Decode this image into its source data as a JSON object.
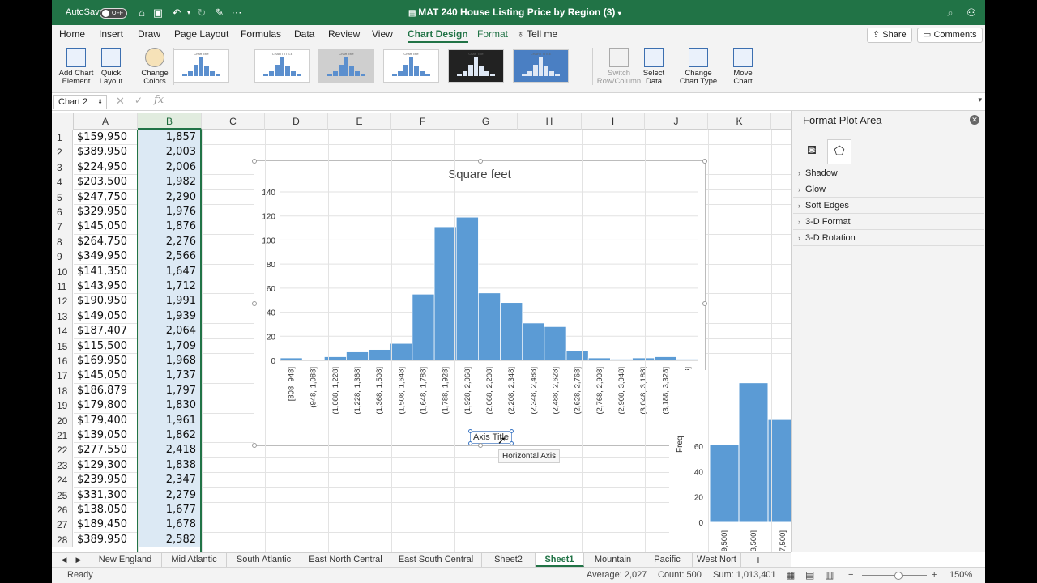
{
  "titlebar": {
    "autosave_label": "AutoSave",
    "autosave_state": "OFF",
    "doc_title": "MAT 240 House Listing Price by Region (3)"
  },
  "menu": {
    "tabs": [
      "Home",
      "Insert",
      "Draw",
      "Page Layout",
      "Formulas",
      "Data",
      "Review",
      "View",
      "Chart Design",
      "Format"
    ],
    "active": "Chart Design",
    "tell_me": "Tell me",
    "share": "Share",
    "comments": "Comments"
  },
  "ribbon": {
    "add_chart_element": "Add Chart Element",
    "quick_layout": "Quick Layout",
    "change_colors": "Change Colors",
    "switch_row_column": "Switch Row/Column",
    "select_data": "Select Data",
    "change_chart_type": "Change Chart Type",
    "move_chart": "Move Chart"
  },
  "formula_bar": {
    "name_box": "Chart 2",
    "fx": "fx"
  },
  "sheet": {
    "columns": [
      "A",
      "B",
      "C",
      "D",
      "E",
      "F",
      "G",
      "H",
      "I",
      "J",
      "K"
    ],
    "rows": [
      {
        "n": "1",
        "a": "$159,950",
        "b": "1,857"
      },
      {
        "n": "2",
        "a": "$389,950",
        "b": "2,003"
      },
      {
        "n": "3",
        "a": "$224,950",
        "b": "2,006"
      },
      {
        "n": "4",
        "a": "$203,500",
        "b": "1,982"
      },
      {
        "n": "5",
        "a": "$247,750",
        "b": "2,290"
      },
      {
        "n": "6",
        "a": "$329,950",
        "b": "1,976"
      },
      {
        "n": "7",
        "a": "$145,050",
        "b": "1,876"
      },
      {
        "n": "8",
        "a": "$264,750",
        "b": "2,276"
      },
      {
        "n": "9",
        "a": "$349,950",
        "b": "2,566"
      },
      {
        "n": "10",
        "a": "$141,350",
        "b": "1,647"
      },
      {
        "n": "11",
        "a": "$143,950",
        "b": "1,712"
      },
      {
        "n": "12",
        "a": "$190,950",
        "b": "1,991"
      },
      {
        "n": "13",
        "a": "$149,050",
        "b": "1,939"
      },
      {
        "n": "14",
        "a": "$187,407",
        "b": "2,064"
      },
      {
        "n": "15",
        "a": "$115,500",
        "b": "1,709"
      },
      {
        "n": "16",
        "a": "$169,950",
        "b": "1,968"
      },
      {
        "n": "17",
        "a": "$145,050",
        "b": "1,737"
      },
      {
        "n": "18",
        "a": "$186,879",
        "b": "1,797"
      },
      {
        "n": "19",
        "a": "$179,800",
        "b": "1,830"
      },
      {
        "n": "20",
        "a": "$179,400",
        "b": "1,961"
      },
      {
        "n": "21",
        "a": "$139,050",
        "b": "1,862"
      },
      {
        "n": "22",
        "a": "$277,550",
        "b": "2,418"
      },
      {
        "n": "23",
        "a": "$129,300",
        "b": "1,838"
      },
      {
        "n": "24",
        "a": "$239,950",
        "b": "2,347"
      },
      {
        "n": "25",
        "a": "$331,300",
        "b": "2,279"
      },
      {
        "n": "26",
        "a": "$138,050",
        "b": "1,677"
      },
      {
        "n": "27",
        "a": "$189,450",
        "b": "1,678"
      },
      {
        "n": "28",
        "a": "$389,950",
        "b": "2,582"
      }
    ]
  },
  "chart": {
    "axis_title": "Axis Title",
    "tooltip": "Horizontal Axis"
  },
  "chart_data": [
    {
      "type": "bar",
      "title": "Square feet",
      "xlabel": "Axis Title",
      "ylabel": "",
      "ylim": [
        0,
        140
      ],
      "yticks": [
        0,
        20,
        40,
        60,
        80,
        100,
        120,
        140
      ],
      "categories": [
        "[808, 948]",
        "(948, 1,088]",
        "(1,088, 1,228]",
        "(1,228, 1,368]",
        "(1,368, 1,508]",
        "(1,508, 1,648]",
        "(1,648, 1,788]",
        "(1,788, 1,928]",
        "(1,928, 2,068]",
        "(2,068, 2,208]",
        "(2,208, 2,348]",
        "(2,348, 2,488]",
        "(2,488, 2,628]",
        "(2,628, 2,768]",
        "(2,768, 2,908]",
        "(2,908, 3,048]",
        "(3,048, 3,188]",
        "(3,188, 3,328]",
        "(3,328, 3,468]"
      ],
      "values": [
        2,
        0,
        3,
        7,
        9,
        14,
        55,
        111,
        119,
        56,
        48,
        31,
        28,
        8,
        2,
        1,
        2,
        3,
        1
      ],
      "grid": true
    },
    {
      "type": "bar",
      "title": "",
      "xlabel": "",
      "ylabel": "Freq",
      "ylim": [
        0,
        120
      ],
      "yticks": [
        0,
        20,
        40,
        60
      ],
      "categories": [
        "9,500]",
        "3,500]",
        "7,500]"
      ],
      "values": [
        61,
        110,
        81
      ],
      "grid": false
    }
  ],
  "pane": {
    "title": "Format Plot Area",
    "sections": [
      "Shadow",
      "Glow",
      "Soft Edges",
      "3-D Format",
      "3-D Rotation"
    ]
  },
  "sheet_tabs": {
    "tabs": [
      "New England",
      "Mid Atlantic",
      "South Atlantic",
      "East North Central",
      "East South Central",
      "Sheet2",
      "Sheet1",
      "Mountain",
      "Pacific",
      "West Nort"
    ],
    "active": "Sheet1",
    "add": "+"
  },
  "status": {
    "ready": "Ready",
    "average": "Average:  2,027",
    "count": "Count: 500",
    "sum": "Sum:  1,013,401",
    "zoom": "150%"
  },
  "colors": {
    "accent": "#217346",
    "bar": "#5b9bd5"
  }
}
